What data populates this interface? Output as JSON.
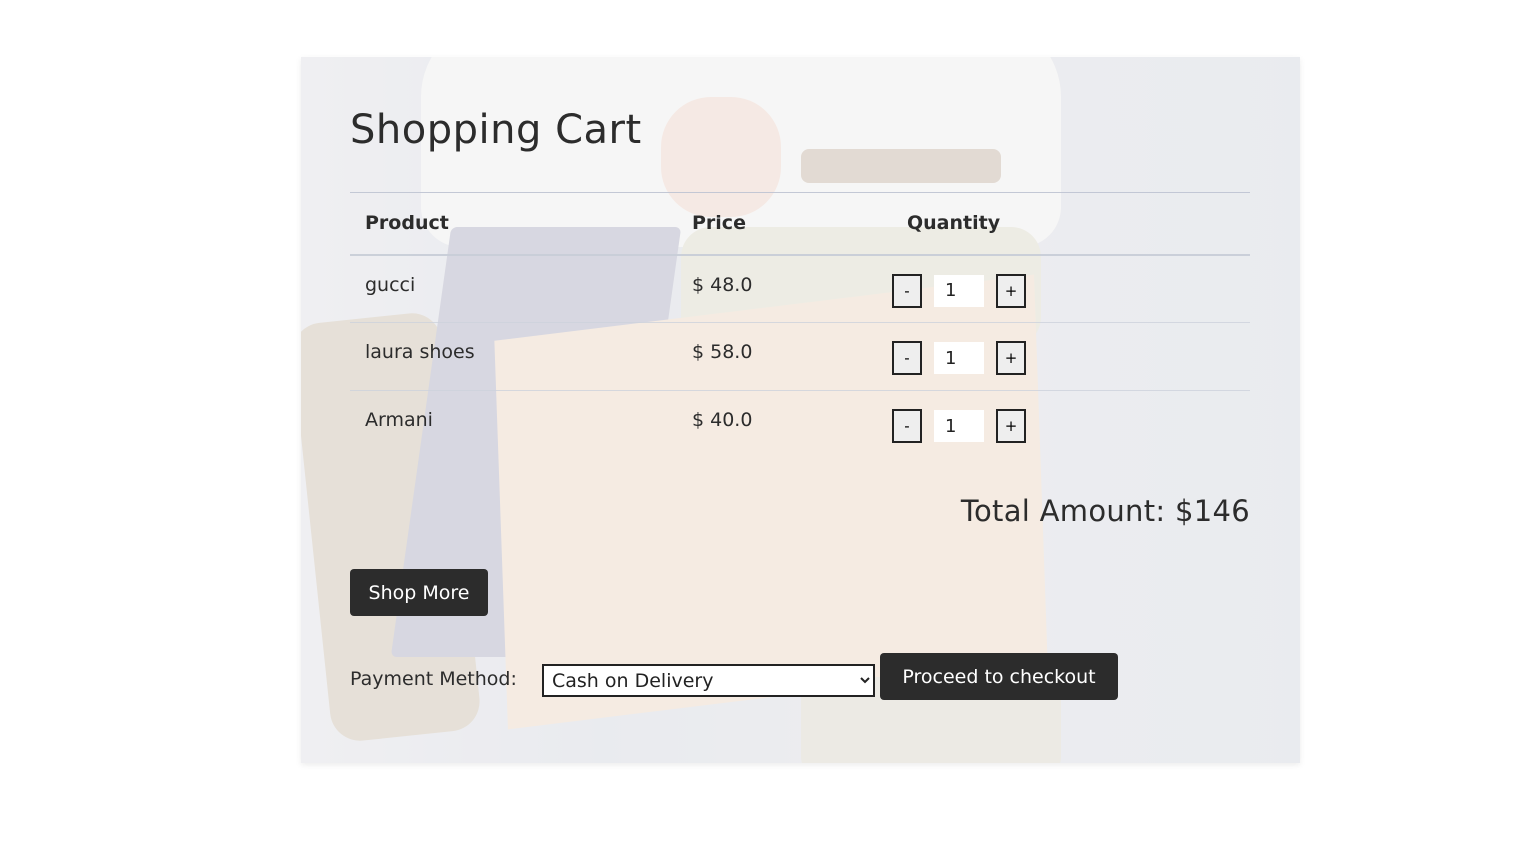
{
  "cart": {
    "title": "Shopping Cart",
    "columns": {
      "product": "Product",
      "price": "Price",
      "quantity": "Quantity"
    },
    "items": [
      {
        "name": "gucci",
        "price": "$ 48.0",
        "quantity": "1"
      },
      {
        "name": "laura shoes",
        "price": "$ 58.0",
        "quantity": "1"
      },
      {
        "name": "Armani",
        "price": "$ 40.0",
        "quantity": "1"
      }
    ],
    "decrement_label": "-",
    "increment_label": "+",
    "total_label": "Total Amount: $146"
  },
  "actions": {
    "shop_more_label": "Shop More",
    "checkout_label": "Proceed to checkout"
  },
  "payment": {
    "label": "Payment Method:",
    "selected": "Cash on Delivery"
  },
  "colors": {
    "button_dark": "#2c2c2c",
    "text": "#2c2c2c",
    "page_bg": "#ffffff"
  }
}
